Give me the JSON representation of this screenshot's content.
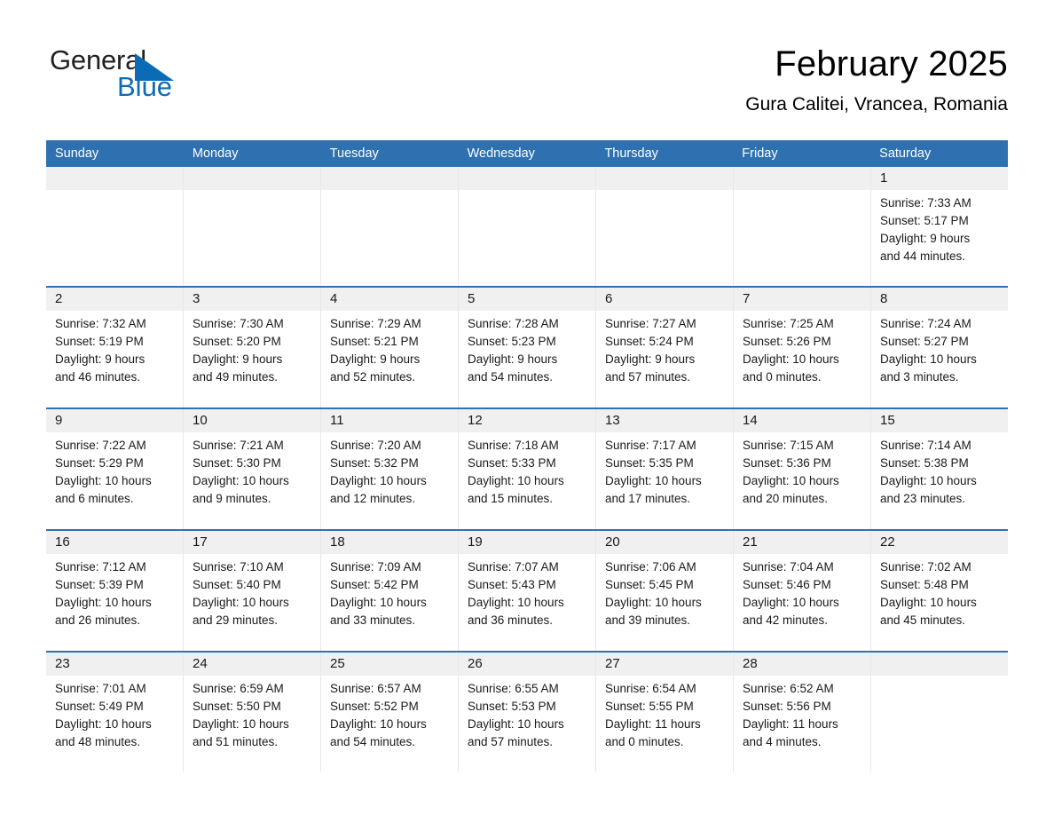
{
  "logo": {
    "word_general": "General",
    "word_blue": "Blue",
    "triangle_color": "#0b6cb5",
    "general_color": "#231f20"
  },
  "header": {
    "title": "February 2025",
    "subtitle": "Gura Calitei, Vrancea, Romania"
  },
  "theme": {
    "header_blue": "#2e70b0",
    "daynum_band": "#f0f0f0",
    "page_background": "#ffffff",
    "cell_divider": "#e8e8e8"
  },
  "weekday_headers": [
    "Sunday",
    "Monday",
    "Tuesday",
    "Wednesday",
    "Thursday",
    "Friday",
    "Saturday"
  ],
  "weeks": [
    [
      {
        "day": "",
        "sunrise": "",
        "sunset": "",
        "daylight_line1": "",
        "daylight_line2": ""
      },
      {
        "day": "",
        "sunrise": "",
        "sunset": "",
        "daylight_line1": "",
        "daylight_line2": ""
      },
      {
        "day": "",
        "sunrise": "",
        "sunset": "",
        "daylight_line1": "",
        "daylight_line2": ""
      },
      {
        "day": "",
        "sunrise": "",
        "sunset": "",
        "daylight_line1": "",
        "daylight_line2": ""
      },
      {
        "day": "",
        "sunrise": "",
        "sunset": "",
        "daylight_line1": "",
        "daylight_line2": ""
      },
      {
        "day": "",
        "sunrise": "",
        "sunset": "",
        "daylight_line1": "",
        "daylight_line2": ""
      },
      {
        "day": "1",
        "sunrise": "Sunrise: 7:33 AM",
        "sunset": "Sunset: 5:17 PM",
        "daylight_line1": "Daylight: 9 hours",
        "daylight_line2": "and 44 minutes."
      }
    ],
    [
      {
        "day": "2",
        "sunrise": "Sunrise: 7:32 AM",
        "sunset": "Sunset: 5:19 PM",
        "daylight_line1": "Daylight: 9 hours",
        "daylight_line2": "and 46 minutes."
      },
      {
        "day": "3",
        "sunrise": "Sunrise: 7:30 AM",
        "sunset": "Sunset: 5:20 PM",
        "daylight_line1": "Daylight: 9 hours",
        "daylight_line2": "and 49 minutes."
      },
      {
        "day": "4",
        "sunrise": "Sunrise: 7:29 AM",
        "sunset": "Sunset: 5:21 PM",
        "daylight_line1": "Daylight: 9 hours",
        "daylight_line2": "and 52 minutes."
      },
      {
        "day": "5",
        "sunrise": "Sunrise: 7:28 AM",
        "sunset": "Sunset: 5:23 PM",
        "daylight_line1": "Daylight: 9 hours",
        "daylight_line2": "and 54 minutes."
      },
      {
        "day": "6",
        "sunrise": "Sunrise: 7:27 AM",
        "sunset": "Sunset: 5:24 PM",
        "daylight_line1": "Daylight: 9 hours",
        "daylight_line2": "and 57 minutes."
      },
      {
        "day": "7",
        "sunrise": "Sunrise: 7:25 AM",
        "sunset": "Sunset: 5:26 PM",
        "daylight_line1": "Daylight: 10 hours",
        "daylight_line2": "and 0 minutes."
      },
      {
        "day": "8",
        "sunrise": "Sunrise: 7:24 AM",
        "sunset": "Sunset: 5:27 PM",
        "daylight_line1": "Daylight: 10 hours",
        "daylight_line2": "and 3 minutes."
      }
    ],
    [
      {
        "day": "9",
        "sunrise": "Sunrise: 7:22 AM",
        "sunset": "Sunset: 5:29 PM",
        "daylight_line1": "Daylight: 10 hours",
        "daylight_line2": "and 6 minutes."
      },
      {
        "day": "10",
        "sunrise": "Sunrise: 7:21 AM",
        "sunset": "Sunset: 5:30 PM",
        "daylight_line1": "Daylight: 10 hours",
        "daylight_line2": "and 9 minutes."
      },
      {
        "day": "11",
        "sunrise": "Sunrise: 7:20 AM",
        "sunset": "Sunset: 5:32 PM",
        "daylight_line1": "Daylight: 10 hours",
        "daylight_line2": "and 12 minutes."
      },
      {
        "day": "12",
        "sunrise": "Sunrise: 7:18 AM",
        "sunset": "Sunset: 5:33 PM",
        "daylight_line1": "Daylight: 10 hours",
        "daylight_line2": "and 15 minutes."
      },
      {
        "day": "13",
        "sunrise": "Sunrise: 7:17 AM",
        "sunset": "Sunset: 5:35 PM",
        "daylight_line1": "Daylight: 10 hours",
        "daylight_line2": "and 17 minutes."
      },
      {
        "day": "14",
        "sunrise": "Sunrise: 7:15 AM",
        "sunset": "Sunset: 5:36 PM",
        "daylight_line1": "Daylight: 10 hours",
        "daylight_line2": "and 20 minutes."
      },
      {
        "day": "15",
        "sunrise": "Sunrise: 7:14 AM",
        "sunset": "Sunset: 5:38 PM",
        "daylight_line1": "Daylight: 10 hours",
        "daylight_line2": "and 23 minutes."
      }
    ],
    [
      {
        "day": "16",
        "sunrise": "Sunrise: 7:12 AM",
        "sunset": "Sunset: 5:39 PM",
        "daylight_line1": "Daylight: 10 hours",
        "daylight_line2": "and 26 minutes."
      },
      {
        "day": "17",
        "sunrise": "Sunrise: 7:10 AM",
        "sunset": "Sunset: 5:40 PM",
        "daylight_line1": "Daylight: 10 hours",
        "daylight_line2": "and 29 minutes."
      },
      {
        "day": "18",
        "sunrise": "Sunrise: 7:09 AM",
        "sunset": "Sunset: 5:42 PM",
        "daylight_line1": "Daylight: 10 hours",
        "daylight_line2": "and 33 minutes."
      },
      {
        "day": "19",
        "sunrise": "Sunrise: 7:07 AM",
        "sunset": "Sunset: 5:43 PM",
        "daylight_line1": "Daylight: 10 hours",
        "daylight_line2": "and 36 minutes."
      },
      {
        "day": "20",
        "sunrise": "Sunrise: 7:06 AM",
        "sunset": "Sunset: 5:45 PM",
        "daylight_line1": "Daylight: 10 hours",
        "daylight_line2": "and 39 minutes."
      },
      {
        "day": "21",
        "sunrise": "Sunrise: 7:04 AM",
        "sunset": "Sunset: 5:46 PM",
        "daylight_line1": "Daylight: 10 hours",
        "daylight_line2": "and 42 minutes."
      },
      {
        "day": "22",
        "sunrise": "Sunrise: 7:02 AM",
        "sunset": "Sunset: 5:48 PM",
        "daylight_line1": "Daylight: 10 hours",
        "daylight_line2": "and 45 minutes."
      }
    ],
    [
      {
        "day": "23",
        "sunrise": "Sunrise: 7:01 AM",
        "sunset": "Sunset: 5:49 PM",
        "daylight_line1": "Daylight: 10 hours",
        "daylight_line2": "and 48 minutes."
      },
      {
        "day": "24",
        "sunrise": "Sunrise: 6:59 AM",
        "sunset": "Sunset: 5:50 PM",
        "daylight_line1": "Daylight: 10 hours",
        "daylight_line2": "and 51 minutes."
      },
      {
        "day": "25",
        "sunrise": "Sunrise: 6:57 AM",
        "sunset": "Sunset: 5:52 PM",
        "daylight_line1": "Daylight: 10 hours",
        "daylight_line2": "and 54 minutes."
      },
      {
        "day": "26",
        "sunrise": "Sunrise: 6:55 AM",
        "sunset": "Sunset: 5:53 PM",
        "daylight_line1": "Daylight: 10 hours",
        "daylight_line2": "and 57 minutes."
      },
      {
        "day": "27",
        "sunrise": "Sunrise: 6:54 AM",
        "sunset": "Sunset: 5:55 PM",
        "daylight_line1": "Daylight: 11 hours",
        "daylight_line2": "and 0 minutes."
      },
      {
        "day": "28",
        "sunrise": "Sunrise: 6:52 AM",
        "sunset": "Sunset: 5:56 PM",
        "daylight_line1": "Daylight: 11 hours",
        "daylight_line2": "and 4 minutes."
      },
      {
        "day": "",
        "sunrise": "",
        "sunset": "",
        "daylight_line1": "",
        "daylight_line2": ""
      }
    ]
  ]
}
